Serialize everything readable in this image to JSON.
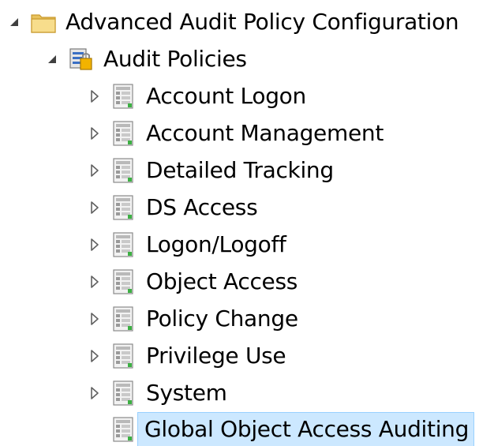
{
  "tree": {
    "root": {
      "label": "Advanced Audit Policy Configuration",
      "icon": "folder-icon",
      "expanded": true
    },
    "audit_policies": {
      "label": "Audit Policies",
      "icon": "audit-policies-icon",
      "expanded": true
    },
    "children": [
      {
        "label": "Account Logon",
        "icon": "policy-list-icon",
        "expanded": false
      },
      {
        "label": "Account Management",
        "icon": "policy-list-icon",
        "expanded": false
      },
      {
        "label": "Detailed Tracking",
        "icon": "policy-list-icon",
        "expanded": false
      },
      {
        "label": "DS Access",
        "icon": "policy-list-icon",
        "expanded": false
      },
      {
        "label": "Logon/Logoff",
        "icon": "policy-list-icon",
        "expanded": false
      },
      {
        "label": "Object Access",
        "icon": "policy-list-icon",
        "expanded": false
      },
      {
        "label": "Policy Change",
        "icon": "policy-list-icon",
        "expanded": false
      },
      {
        "label": "Privilege Use",
        "icon": "policy-list-icon",
        "expanded": false
      },
      {
        "label": "System",
        "icon": "policy-list-icon",
        "expanded": false
      },
      {
        "label": "Global Object Access Auditing",
        "icon": "policy-list-icon",
        "expanded": null,
        "selected": true
      }
    ]
  },
  "colors": {
    "selection_bg": "#cce8ff",
    "selection_border": "#99d1ff",
    "folder": "#f5d77a",
    "arrow": "#555555"
  }
}
